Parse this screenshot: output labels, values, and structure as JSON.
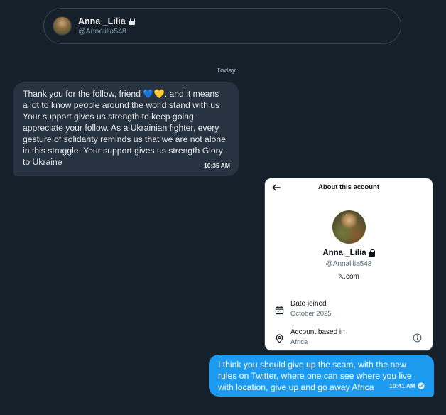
{
  "header": {
    "name": "Anna _Lilia",
    "handle": "@Annalilia548",
    "avatar_icon": "avatar-photo",
    "lock_icon": "lock-icon"
  },
  "day_divider": "Today",
  "incoming_message": {
    "text": "Thank you for the follow, friend 💙💛.  and it means\na lot to know people around the world stand with us\nYour support gives us strength to keep going.\nappreciate your follow. As a Ukrainian fighter, every\ngesture of solidarity reminds us that we are not alone\nin this struggle. Your support gives us strength Glory\nto Ukraine",
    "time": "10:35 AM"
  },
  "about_account_image": {
    "title": "About this account",
    "name": "Anna _Lilia",
    "handle": "@Annalilia548",
    "domain": "𝕏.com",
    "date_joined_label": "Date joined",
    "date_joined_value": "October 2025",
    "based_in_label": "Account based in",
    "based_in_value": "Africa"
  },
  "outgoing_message": {
    "text": "I think you should give up the scam, with the new\nrules on Twitter, where one can see where you live\nwith location, give up and go away Africa",
    "time": "10:41 AM",
    "status_icon": "check-circle-icon"
  },
  "colors": {
    "background": "#15202b",
    "incoming_bubble": "#273340",
    "outgoing_bubble": "#1d9bf0"
  }
}
